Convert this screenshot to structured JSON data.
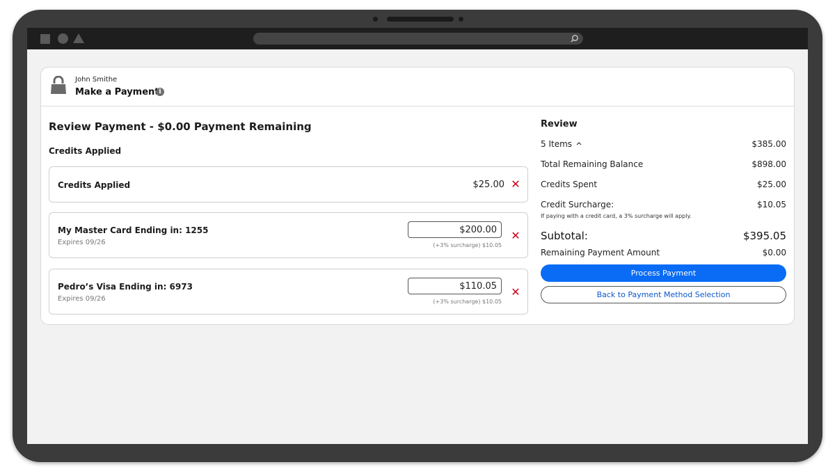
{
  "header": {
    "user_name": "John Smithe",
    "title": "Make a Payment",
    "lock_icon": "lock-icon",
    "info_icon": "info-icon"
  },
  "main": {
    "title": "Review Payment - $0.00 Payment Remaining",
    "credits_heading": "Credits Applied",
    "rows": [
      {
        "label": "Credits Applied",
        "amount": "$25.00"
      },
      {
        "label": "My Master Card Ending in: 1255",
        "expires": "Expires 09/26",
        "amount": "$200.00",
        "surcharge": "(+3% surcharge) $10.05"
      },
      {
        "label": "Pedro’s Visa Ending in: 6973",
        "expires": "Expires 09/26",
        "amount": "$110.05",
        "surcharge": "(+3% surcharge) $10.05"
      }
    ],
    "remove_glyph": "✕"
  },
  "review": {
    "title": "Review",
    "items_label": "5 Items",
    "items_value": "$385.00",
    "balance_label": "Total Remaining Balance",
    "balance_value": "$898.00",
    "credits_label": "Credits Spent",
    "credits_value": "$25.00",
    "surcharge_label": "Credit Surcharge:",
    "surcharge_value": "$10.05",
    "surcharge_note": "If paying with a credit card, a 3% surcharge will apply.",
    "subtotal_label": "Subtotal:",
    "subtotal_value": "$395.05",
    "remaining_label": "Remaining Payment Amount",
    "remaining_value": "$0.00",
    "process_button": "Process Payment",
    "back_button": "Back to Payment Method Selection"
  },
  "colors": {
    "primary": "#0a6cf5",
    "remove": "#d0021b"
  }
}
